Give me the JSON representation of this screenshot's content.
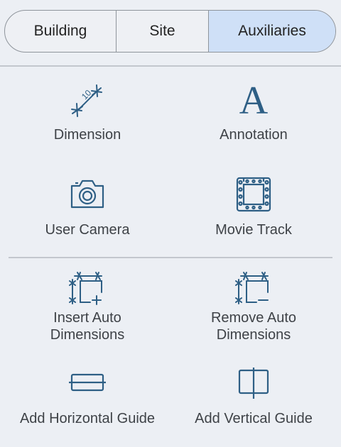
{
  "tabs": [
    {
      "label": "Building",
      "active": false
    },
    {
      "label": "Site",
      "active": false
    },
    {
      "label": "Auxiliaries",
      "active": true
    }
  ],
  "colors": {
    "icon": "#2e5f85",
    "active_tab": "#cfe0f7",
    "background": "#eceff4"
  },
  "tools": {
    "dimension": {
      "label": "Dimension",
      "icon": "dimension-icon",
      "icon_text": "10"
    },
    "annotation": {
      "label": "Annotation",
      "icon": "annotation-icon",
      "icon_text": "A"
    },
    "user_camera": {
      "label": "User Camera",
      "icon": "camera-icon"
    },
    "movie_track": {
      "label": "Movie Track",
      "icon": "film-icon"
    },
    "insert_auto_dimensions": {
      "label": "Insert Auto\nDimensions",
      "icon": "insert-auto-dimensions-icon"
    },
    "remove_auto_dimensions": {
      "label": "Remove Auto\nDimensions",
      "icon": "remove-auto-dimensions-icon"
    },
    "add_horizontal_guide": {
      "label": "Add Horizontal Guide",
      "icon": "horizontal-guide-icon"
    },
    "add_vertical_guide": {
      "label": "Add Vertical Guide",
      "icon": "vertical-guide-icon"
    }
  }
}
